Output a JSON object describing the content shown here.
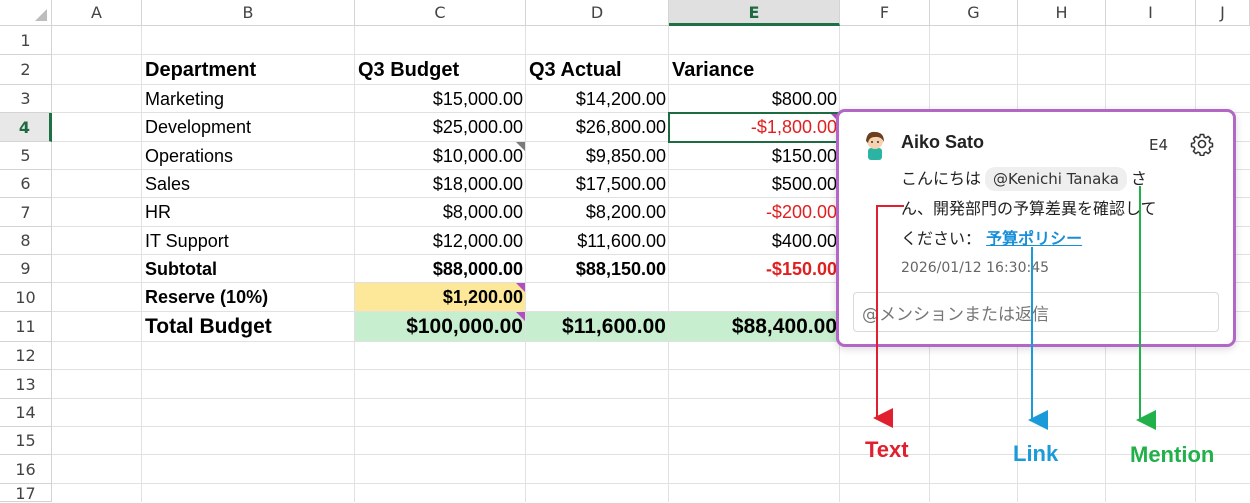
{
  "columns": [
    "A",
    "B",
    "C",
    "D",
    "E",
    "F",
    "G",
    "H",
    "I",
    "J"
  ],
  "selected_column": "E",
  "rows": [
    "1",
    "2",
    "3",
    "4",
    "5",
    "6",
    "7",
    "8",
    "9",
    "10",
    "11",
    "12",
    "13",
    "14",
    "15",
    "16",
    "17"
  ],
  "selected_row": "4",
  "table": {
    "headers": [
      "Department",
      "Q3 Budget",
      "Q3 Actual",
      "Variance"
    ],
    "data": [
      [
        "Marketing",
        "$15,000.00",
        "$14,200.00",
        "$800.00"
      ],
      [
        "Development",
        "$25,000.00",
        "$26,800.00",
        "-$1,800.00"
      ],
      [
        "Operations",
        "$10,000.00",
        "$9,850.00",
        "$150.00"
      ],
      [
        "Sales",
        "$18,000.00",
        "$17,500.00",
        "$500.00"
      ],
      [
        "HR",
        "$8,000.00",
        "$8,200.00",
        "-$200.00"
      ],
      [
        "IT Support",
        "$12,000.00",
        "$11,600.00",
        "$400.00"
      ]
    ],
    "subtotal": [
      "Subtotal",
      "$88,000.00",
      "$88,150.00",
      "-$150.00"
    ],
    "reserve": [
      "Reserve (10%)",
      "$1,200.00"
    ],
    "total": [
      "Total Budget",
      "$100,000.00",
      "$11,600.00",
      "$88,400.00"
    ]
  },
  "comment": {
    "author": "Aiko Sato",
    "cell_ref": "E4",
    "text_before": "こんにちは",
    "mention": "@Kenichi Tanaka",
    "text_after_1": "さ",
    "text_line2": "ん、開発部門の予算差異を確認して",
    "text_line3": "ください：",
    "link_text": "予算ポリシー",
    "timestamp": "2026/01/12 16:30:45",
    "reply_placeholder": "@メンションまたは返信"
  },
  "annotations": {
    "text_label": "Text",
    "link_label": "Link",
    "mention_label": "Mention",
    "text_color": "#e0202e",
    "link_color": "#1a9ad8",
    "mention_color": "#22b04a"
  },
  "icons": [
    "avatar-icon",
    "gear-icon",
    "corner-select-icon"
  ]
}
